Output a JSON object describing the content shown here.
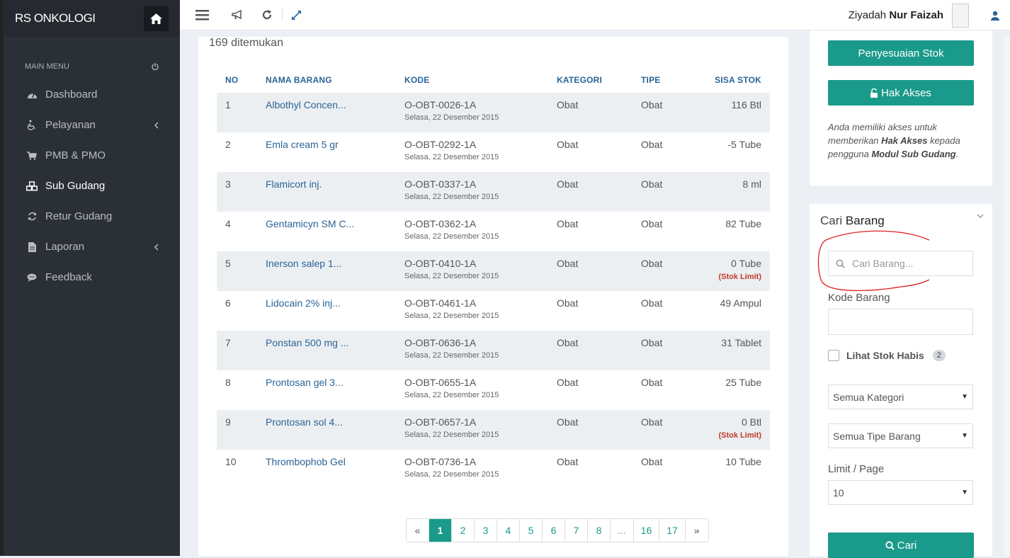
{
  "sidebar": {
    "brand": "RS ONKOLOGI",
    "menu_heading": "MAIN MENU",
    "items": [
      {
        "label": "Dashboard",
        "icon": "dashboard-icon",
        "has_arrow": false,
        "active": false
      },
      {
        "label": "Pelayanan",
        "icon": "wheelchair-icon",
        "has_arrow": true,
        "active": false
      },
      {
        "label": "PMB & PMO",
        "icon": "cart-icon",
        "has_arrow": false,
        "active": false
      },
      {
        "label": "Sub Gudang",
        "icon": "cubes-icon",
        "has_arrow": false,
        "active": true
      },
      {
        "label": "Retur Gudang",
        "icon": "refresh-icon",
        "has_arrow": false,
        "active": false
      },
      {
        "label": "Laporan",
        "icon": "file-icon",
        "has_arrow": true,
        "active": false
      },
      {
        "label": "Feedback",
        "icon": "comment-icon",
        "has_arrow": false,
        "active": false
      }
    ]
  },
  "topbar": {
    "user_first": "Ziyadah",
    "user_last": "Nur Faizah"
  },
  "main": {
    "found_text": "169 ditemukan",
    "columns": [
      "NO",
      "NAMA BARANG",
      "KODE",
      "KATEGORI",
      "TIPE",
      "SISA STOK"
    ],
    "rows": [
      {
        "no": "1",
        "nama": "Albothyl Concen...",
        "kode": "O-OBT-0026-1A",
        "tanggal": "Selasa, 22 Desember 2015",
        "kategori": "Obat",
        "tipe": "Obat",
        "sisa": "116 Btl",
        "limit": ""
      },
      {
        "no": "2",
        "nama": "Emla cream 5 gr",
        "kode": "O-OBT-0292-1A",
        "tanggal": "Selasa, 22 Desember 2015",
        "kategori": "Obat",
        "tipe": "Obat",
        "sisa": "-5 Tube",
        "limit": ""
      },
      {
        "no": "3",
        "nama": "Flamicort inj.",
        "kode": "O-OBT-0337-1A",
        "tanggal": "Selasa, 22 Desember 2015",
        "kategori": "Obat",
        "tipe": "Obat",
        "sisa": "8 ml",
        "limit": ""
      },
      {
        "no": "4",
        "nama": "Gentamicyn SM C...",
        "kode": "O-OBT-0362-1A",
        "tanggal": "Selasa, 22 Desember 2015",
        "kategori": "Obat",
        "tipe": "Obat",
        "sisa": "82 Tube",
        "limit": ""
      },
      {
        "no": "5",
        "nama": "Inerson salep 1...",
        "kode": "O-OBT-0410-1A",
        "tanggal": "Selasa, 22 Desember 2015",
        "kategori": "Obat",
        "tipe": "Obat",
        "sisa": "0 Tube",
        "limit": "(Stok Limit)"
      },
      {
        "no": "6",
        "nama": "Lidocain 2% inj...",
        "kode": "O-OBT-0461-1A",
        "tanggal": "Selasa, 22 Desember 2015",
        "kategori": "Obat",
        "tipe": "Obat",
        "sisa": "49 Ampul",
        "limit": ""
      },
      {
        "no": "7",
        "nama": "Ponstan 500 mg ...",
        "kode": "O-OBT-0636-1A",
        "tanggal": "Selasa, 22 Desember 2015",
        "kategori": "Obat",
        "tipe": "Obat",
        "sisa": "31 Tablet",
        "limit": ""
      },
      {
        "no": "8",
        "nama": "Prontosan gel 3...",
        "kode": "O-OBT-0655-1A",
        "tanggal": "Selasa, 22 Desember 2015",
        "kategori": "Obat",
        "tipe": "Obat",
        "sisa": "25 Tube",
        "limit": ""
      },
      {
        "no": "9",
        "nama": "Prontosan sol 4...",
        "kode": "O-OBT-0657-1A",
        "tanggal": "Selasa, 22 Desember 2015",
        "kategori": "Obat",
        "tipe": "Obat",
        "sisa": "0 Btl",
        "limit": "(Stok Limit)"
      },
      {
        "no": "10",
        "nama": "Thrombophob Gel",
        "kode": "O-OBT-0736-1A",
        "tanggal": "Selasa, 22 Desember 2015",
        "kategori": "Obat",
        "tipe": "Obat",
        "sisa": "10 Tube",
        "limit": ""
      }
    ],
    "pagination": [
      "«",
      "1",
      "2",
      "3",
      "4",
      "5",
      "6",
      "7",
      "8",
      "...",
      "16",
      "17",
      "»"
    ],
    "current_page": "1"
  },
  "right": {
    "btn_penyesuaian": "Penyesuaian Stok",
    "btn_hak_akses": "Hak Akses",
    "info_1": "Anda memiliki akses untuk memberikan ",
    "info_bold_1": "Hak Akses",
    "info_2": " kepada pengguna ",
    "info_bold_2": "Modul Sub Gudang",
    "info_3": ".",
    "cari_title_1": "Cari",
    "cari_title_2": "Barang",
    "search_placeholder": "Cari Barang...",
    "kode_label": "Kode Barang",
    "kode_value": "",
    "lihat_label": "Lihat Stok Habis",
    "lihat_count": "2",
    "kategori_select": "Semua Kategori",
    "tipe_select": "Semua Tipe Barang",
    "limit_label": "Limit / Page",
    "limit_select": "10",
    "btn_cari": "Cari"
  },
  "colors": {
    "accent": "#1a9a8a",
    "sidebar": "#2b3037",
    "link": "#2a6496",
    "limit": "#c0392b",
    "annotation": "#e02020"
  }
}
